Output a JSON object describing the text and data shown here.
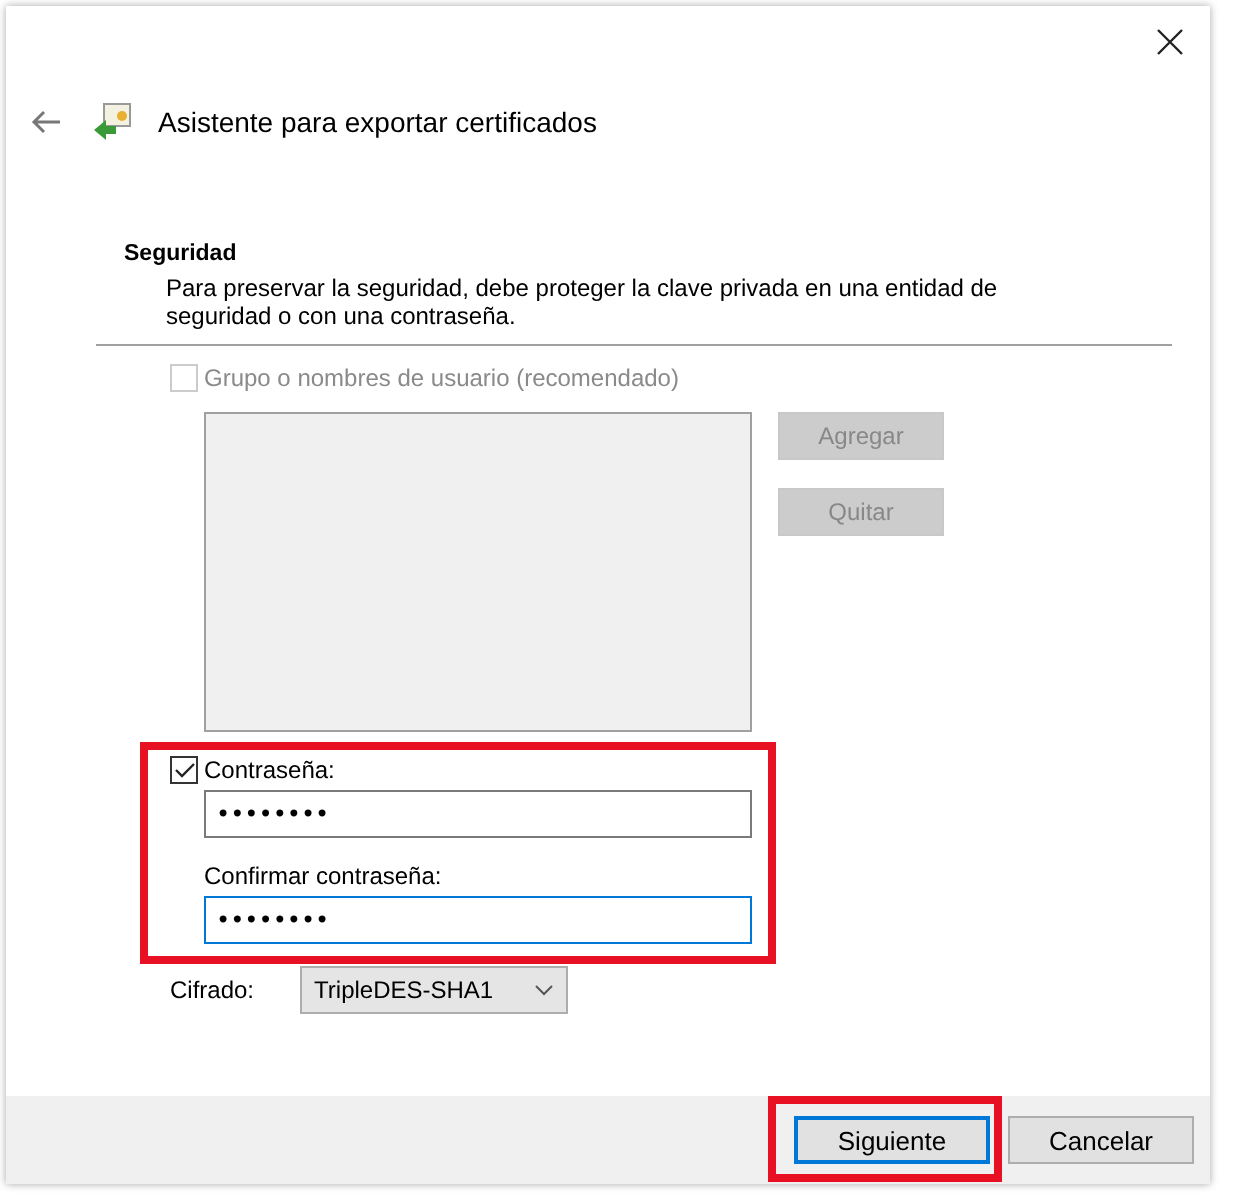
{
  "window": {
    "title": "Asistente para exportar certificados"
  },
  "section": {
    "heading": "Seguridad",
    "description": "Para preservar la seguridad, debe proteger la clave privada en una entidad de seguridad o con una contraseña."
  },
  "group_option": {
    "label": "Grupo o nombres de usuario (recomendado)",
    "checked": false,
    "disabled": true
  },
  "group_buttons": [
    {
      "label": "Agregar",
      "disabled": true
    },
    {
      "label": "Quitar",
      "disabled": true
    }
  ],
  "password": {
    "label": "Contraseña:",
    "checked": true,
    "highlighted": true,
    "value": "••••••••",
    "confirm_label": "Confirmar contraseña:",
    "confirm_value": "••••••••",
    "confirm_focused": true
  },
  "encryption": {
    "label": "Cifrado:",
    "value": "TripleDES-SHA1"
  },
  "buttons": [
    {
      "label": "Siguiente",
      "default": true,
      "highlighted": true
    },
    {
      "label": "Cancelar",
      "default": false,
      "highlighted": false
    }
  ]
}
